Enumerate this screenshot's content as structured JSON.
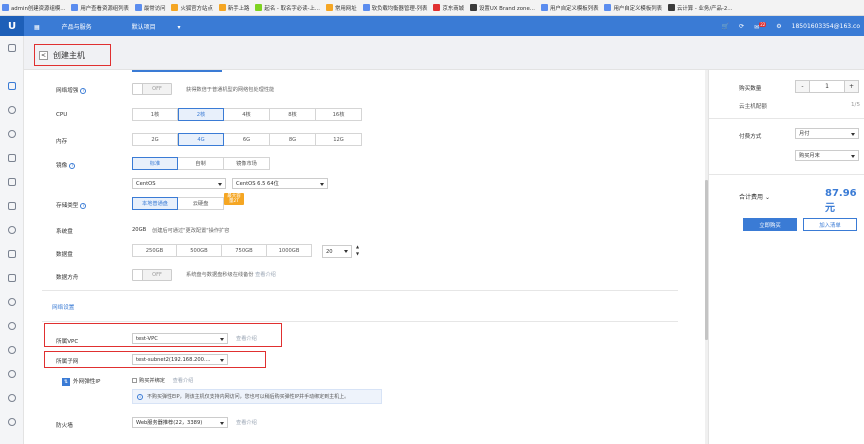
{
  "bookmarks": [
    {
      "label": "admin创建资源组模...",
      "color": "#5b8def"
    },
    {
      "label": "用户查看资源组列表",
      "color": "#5b8def"
    },
    {
      "label": "最常访问",
      "color": "#5b8def"
    },
    {
      "label": "火狐官方站点",
      "color": "#f5a623"
    },
    {
      "label": "新手上路",
      "color": "#f5a623"
    },
    {
      "label": "起名 - 取名字必读-上...",
      "color": "#7ed321"
    },
    {
      "label": "常用网址",
      "color": "#f5a623"
    },
    {
      "label": "软负载均衡器管理-列表",
      "color": "#5b8def"
    },
    {
      "label": "京东商城",
      "color": "#e03030"
    },
    {
      "label": "设置UX Brand zone...",
      "color": "#3a3a3a"
    },
    {
      "label": "用户自定义模板列表",
      "color": "#5b8def"
    },
    {
      "label": "用户自定义模板列表",
      "color": "#5b8def"
    },
    {
      "label": "云计算 - 业务/产品-2...",
      "color": "#3a3a3a"
    }
  ],
  "topbar": {
    "logo": "U",
    "products": "产品与服务",
    "project": "默认项目",
    "project_caret": "▾",
    "notif_count": "22",
    "user": "18501603354@163.co"
  },
  "header": {
    "back": "<",
    "title": "创建主机"
  },
  "network_boost": {
    "label": "网络增强",
    "toggle": "OFF",
    "note": "获得数倍于普通机型的网络包处理性能"
  },
  "cpu": {
    "label": "CPU",
    "options": [
      "1核",
      "2核",
      "4核",
      "8核",
      "16核"
    ],
    "selected": 1
  },
  "memory": {
    "label": "内存",
    "options": [
      "2G",
      "4G",
      "6G",
      "8G",
      "12G"
    ],
    "selected": 1
  },
  "image": {
    "label": "镜像",
    "tabs": [
      "标准",
      "自制",
      "镜像市场"
    ],
    "selected": 0,
    "os": "CentOS",
    "version": "CentOS 6.5 64位"
  },
  "storage": {
    "label": "存储类型",
    "options": [
      "本地普通盘",
      "云硬盘"
    ],
    "selected": 0,
    "badge": "最大容量2T"
  },
  "system_disk": {
    "label": "系统盘",
    "value": "20GB",
    "note": "创建后可通过\"更改配置\"操作扩容"
  },
  "data_disk": {
    "label": "数据盘",
    "ticks": [
      "250GB",
      "500GB",
      "750GB",
      "1000GB"
    ],
    "value": "20"
  },
  "data_protect": {
    "label": "数据方舟",
    "toggle": "OFF",
    "note": "系统盘与数据盘秒级在线备份",
    "link": "查看介绍"
  },
  "section_network": "网络设置",
  "vpc": {
    "label": "所属VPC",
    "value": "test-VPC",
    "link": "查看介绍"
  },
  "subnet": {
    "label": "所属子网",
    "value": "test-subnet2(192.168.200...."
  },
  "eip": {
    "label": "外网弹性IP",
    "checkbox": "购买并绑定",
    "link": "查看介绍",
    "info": "不购买弹性EIP，则该主机仅支持内网访问，您也可以稍后购买弹性IP并手动绑定到主机上。"
  },
  "firewall": {
    "label": "防火墙",
    "value": "Web服务器推荐(22，3389)",
    "link": "查看介绍"
  },
  "order": {
    "qty_label": "购买数量",
    "qty": "1",
    "minus": "-",
    "plus": "+",
    "host_config": "云主机配额",
    "host_quota": "1/5",
    "pay_label": "付费方式",
    "pay": "月付",
    "pay_period": "购买月末",
    "total_label": "合计费用",
    "total": "87.96元",
    "buy": "立即购买",
    "cart": "加入清单"
  },
  "colors": {
    "accent": "#3a7bd5",
    "red": "#e03030",
    "price": "#3a7bd5"
  }
}
